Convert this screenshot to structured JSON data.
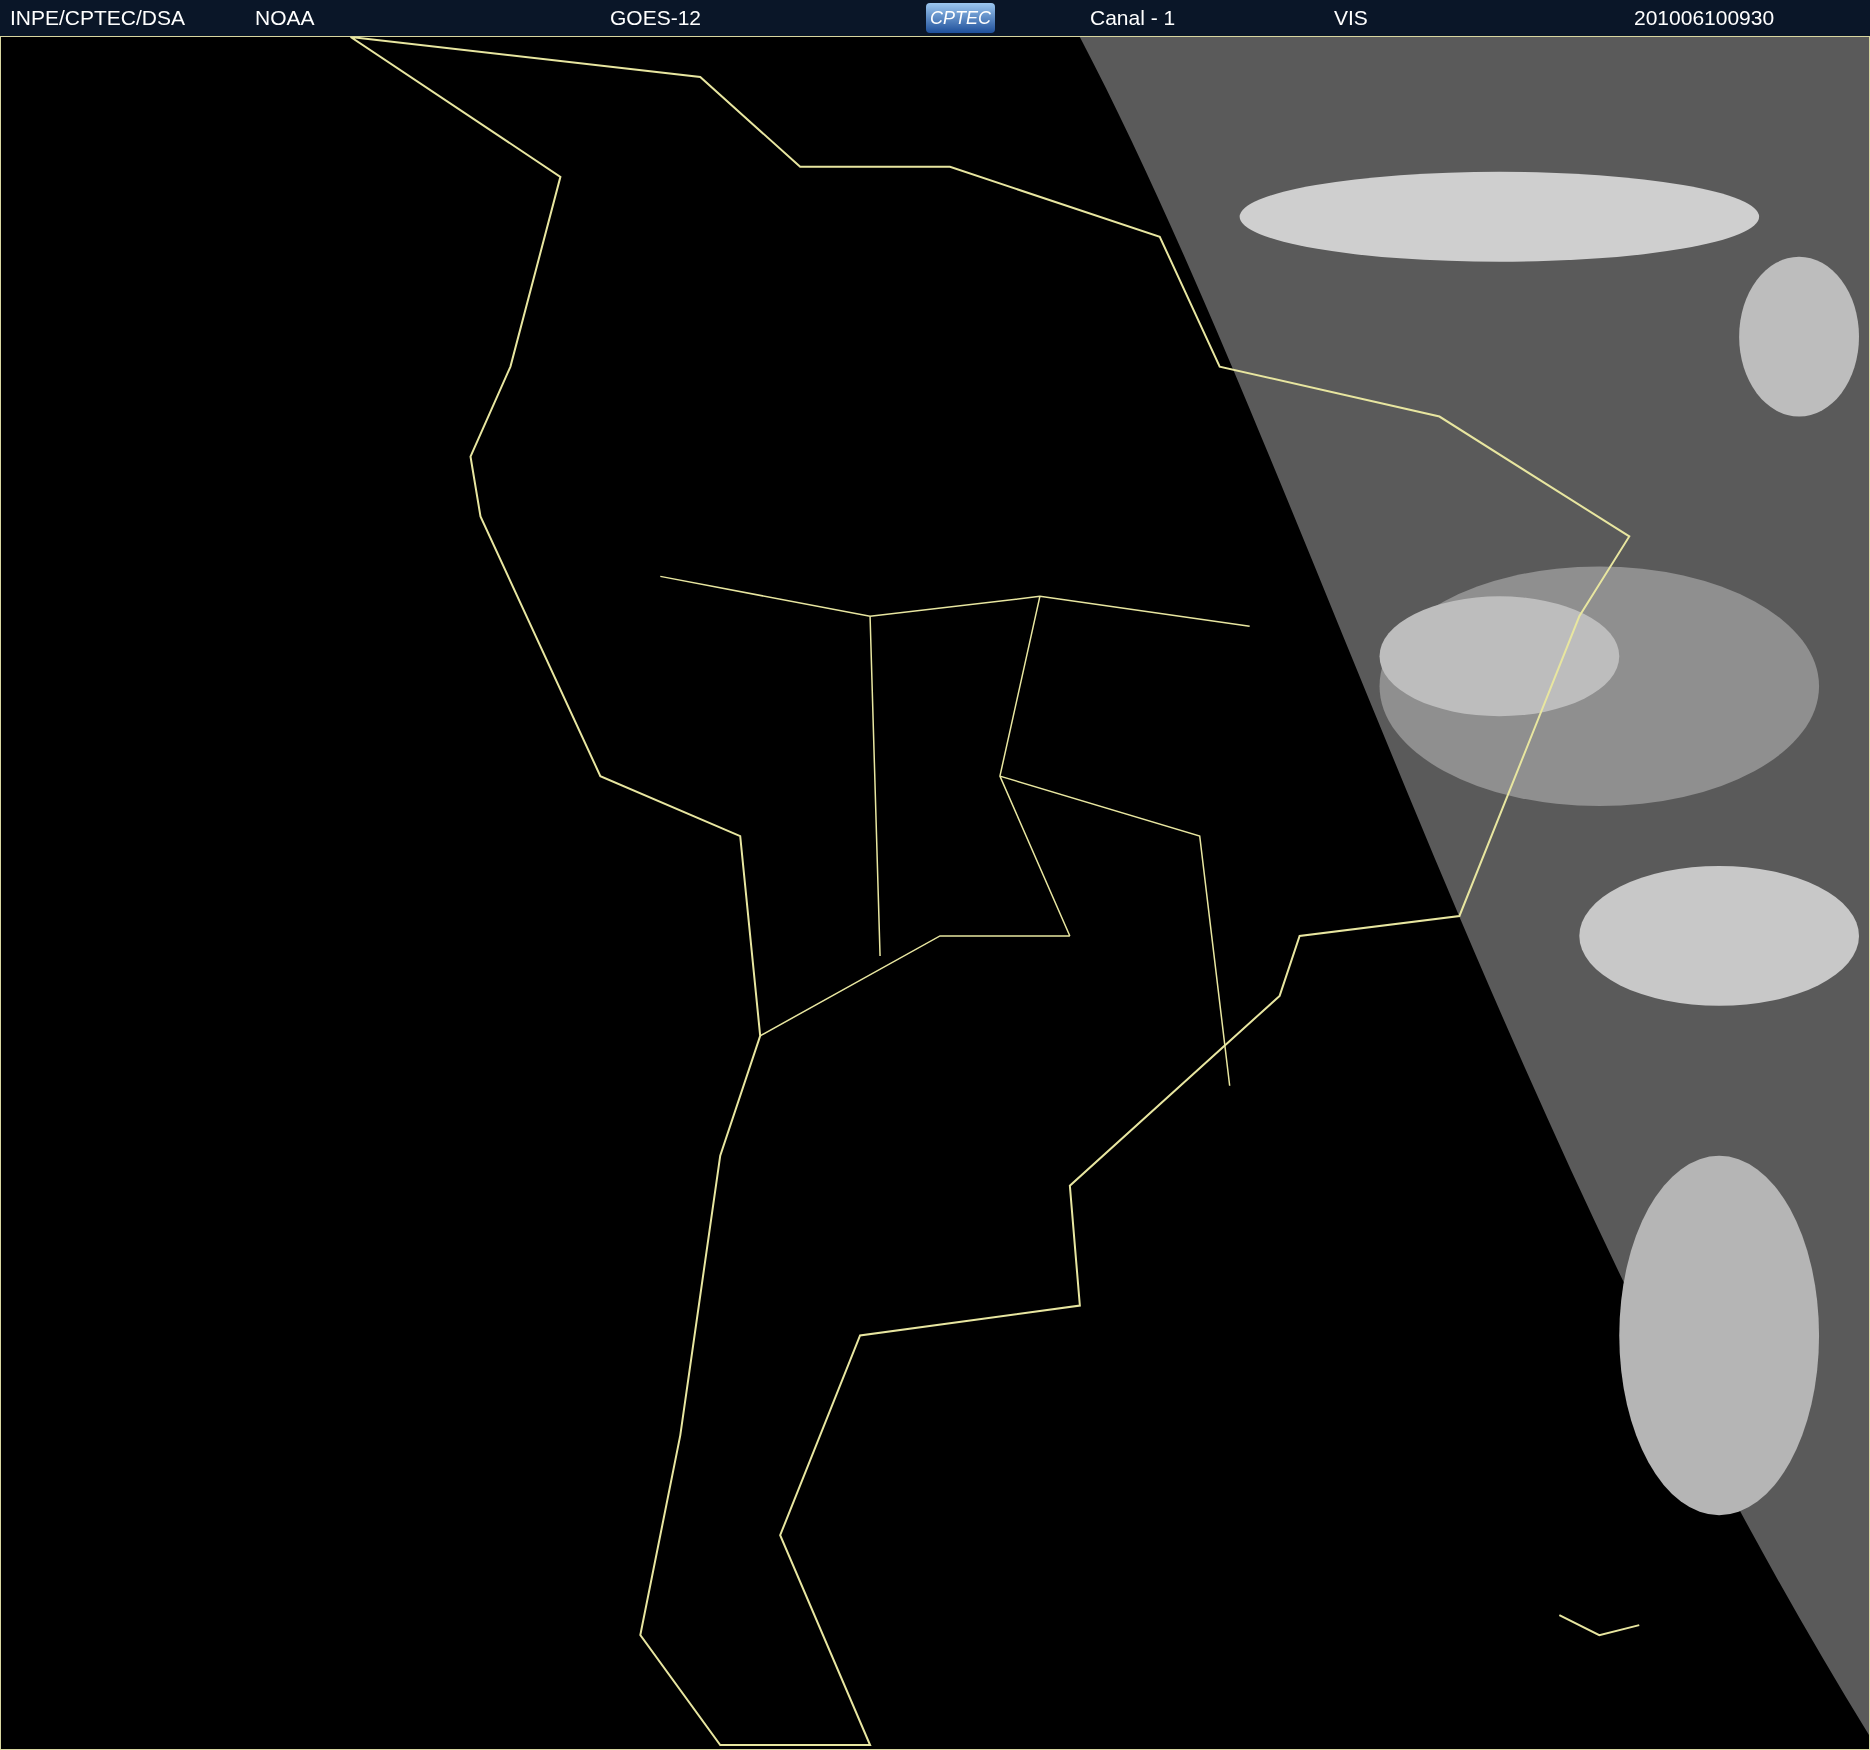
{
  "header": {
    "items": [
      {
        "kind": "text",
        "label": "INPE/CPTEC/DSA"
      },
      {
        "kind": "text",
        "label": "NOAA"
      },
      {
        "kind": "text",
        "label": "GOES-12"
      },
      {
        "kind": "logo",
        "label": "CPTEC"
      },
      {
        "kind": "text",
        "label": "Canal - 1"
      },
      {
        "kind": "text",
        "label": "VIS"
      },
      {
        "kind": "text",
        "label": "201006100930"
      }
    ]
  }
}
